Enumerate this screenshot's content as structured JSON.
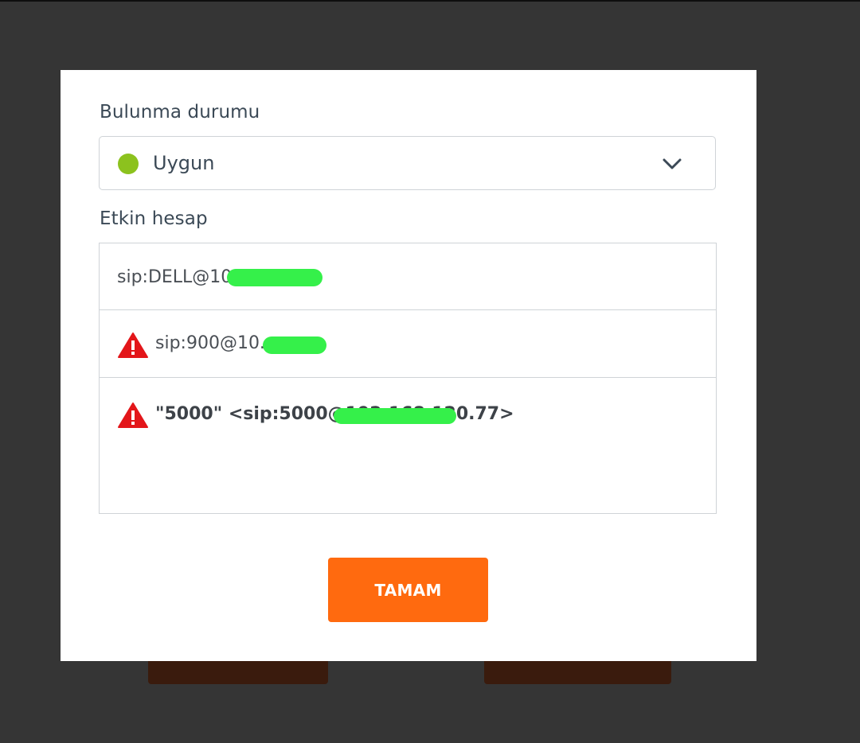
{
  "dialog": {
    "status_label": "Bulunma durumu",
    "status_value": "Uygun",
    "status_color": "#8cc21e",
    "active_account_label": "Etkin hesap",
    "accounts": [
      {
        "text": "sip:DELL@10",
        "warning": false
      },
      {
        "text": "sip:900@10.",
        "warning": true
      },
      {
        "text": "\"5000\" <sip:5000@192.168.120.77>",
        "warning": true
      }
    ],
    "ok_label": "TAMAM"
  },
  "colors": {
    "accent": "#ff6a0f",
    "warning": "#e3161a",
    "redaction": "#35f04a"
  }
}
